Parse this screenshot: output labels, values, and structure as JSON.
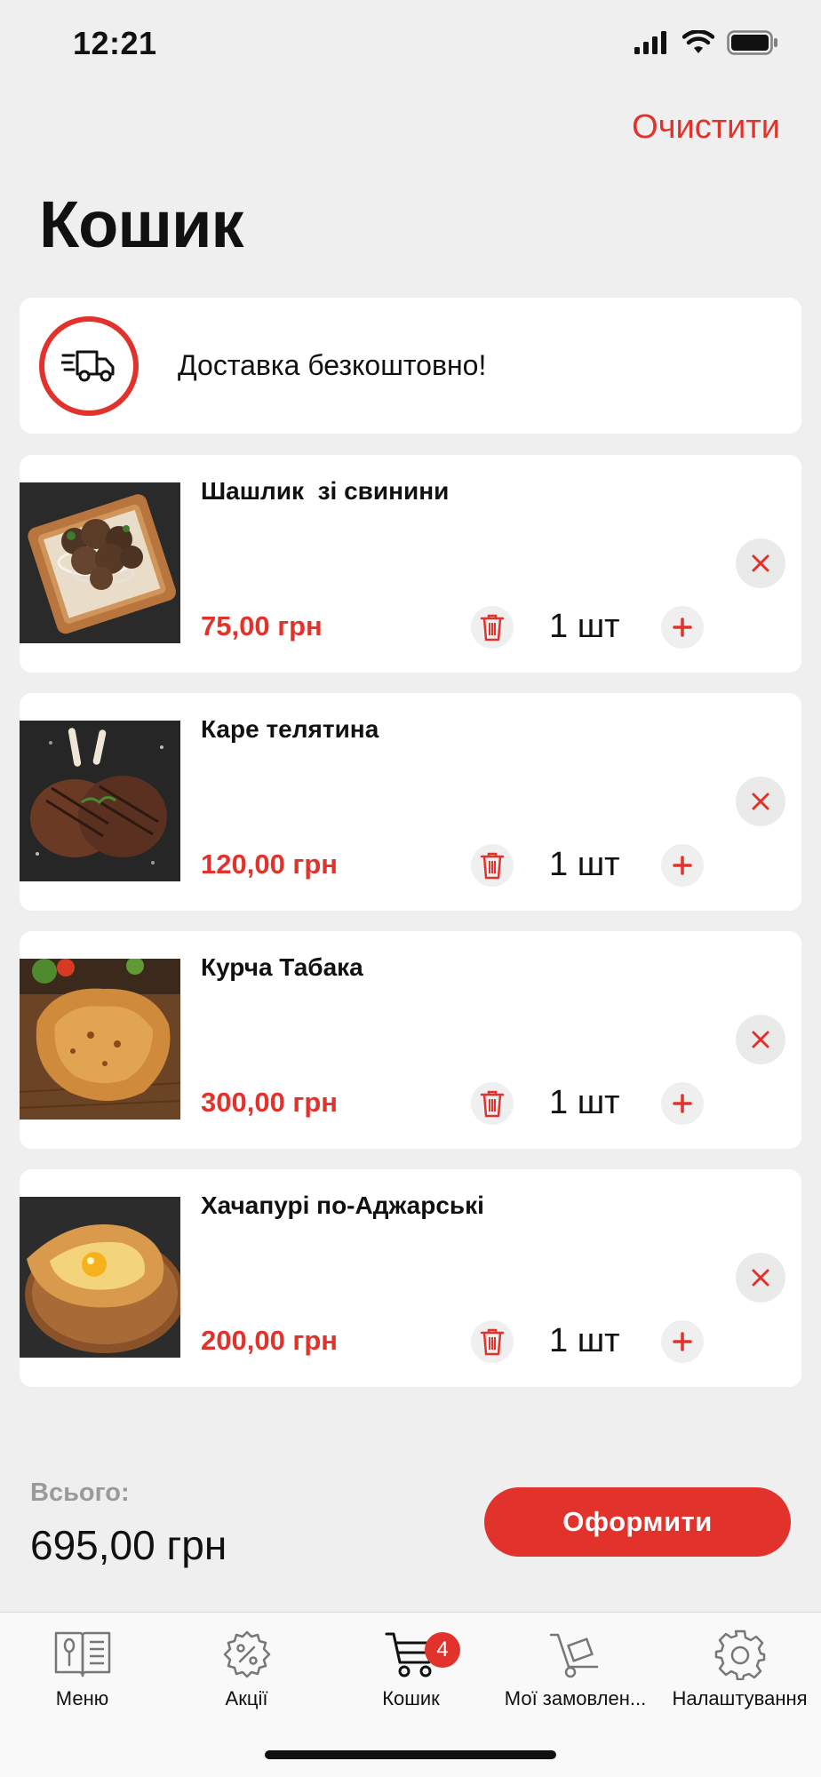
{
  "status_bar": {
    "time": "12:21"
  },
  "header": {
    "clear_label": "Очистити",
    "title": "Кошик"
  },
  "delivery": {
    "text": "Доставка безкоштовно!"
  },
  "cart": {
    "items": [
      {
        "name": "Шашлик  зі свинини",
        "price": "75,00 грн",
        "quantity": "1 шт"
      },
      {
        "name": "Каре телятина",
        "price": "120,00 грн",
        "quantity": "1 шт"
      },
      {
        "name": "Курча Табака",
        "price": "300,00 грн",
        "quantity": "1 шт"
      },
      {
        "name": "Хачапурі по-Аджарські",
        "price": "200,00 грн",
        "quantity": "1 шт"
      }
    ]
  },
  "summary": {
    "total_label": "Всього:",
    "total_value": "695,00 грн",
    "checkout_label": "Оформити"
  },
  "tab_bar": {
    "tabs": [
      {
        "label": "Меню",
        "icon": "menu-book-icon"
      },
      {
        "label": "Акції",
        "icon": "discount-icon"
      },
      {
        "label": "Кошик",
        "icon": "cart-icon",
        "badge": "4"
      },
      {
        "label": "Мої замовлен...",
        "icon": "orders-cart-icon"
      },
      {
        "label": "Налаштування",
        "icon": "gear-icon"
      }
    ]
  },
  "colors": {
    "accent": "#e1332b",
    "background": "#efeff0",
    "card": "#ffffff"
  }
}
